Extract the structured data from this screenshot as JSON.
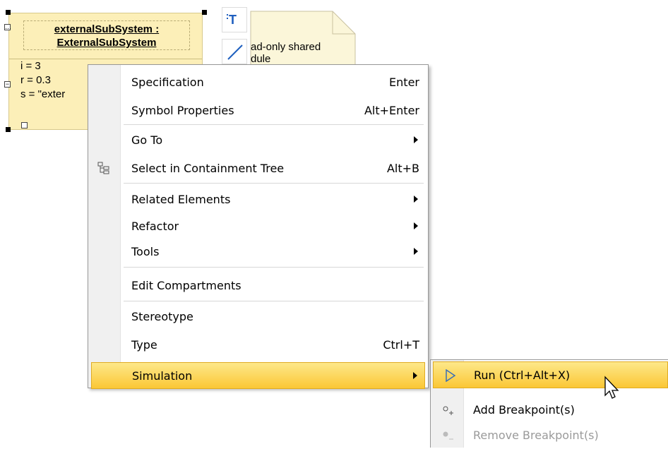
{
  "diagram": {
    "instance": {
      "name_line1": "externalSubSystem :",
      "name_line2": "ExternalSubSystem",
      "slots": [
        "i = 3",
        "r = 0.3",
        "s = \"exter"
      ]
    },
    "note_text": [
      "ad-only shared",
      "dule"
    ]
  },
  "context_menu": {
    "items": [
      {
        "label": "Specification",
        "shortcut": "Enter"
      },
      {
        "label": "Symbol Properties",
        "shortcut": "Alt+Enter"
      },
      {
        "label": "Go To",
        "shortcut": ""
      },
      {
        "label": "Select in Containment Tree",
        "shortcut": "Alt+B"
      },
      {
        "label": "Related Elements",
        "shortcut": ""
      },
      {
        "label": "Refactor",
        "shortcut": ""
      },
      {
        "label": "Tools",
        "shortcut": ""
      },
      {
        "label": "Edit Compartments",
        "shortcut": ""
      },
      {
        "label": "Stereotype",
        "shortcut": ""
      },
      {
        "label": "Type",
        "shortcut": "Ctrl+T"
      },
      {
        "label": "Simulation",
        "shortcut": ""
      }
    ],
    "highlight_item": "Simulation"
  },
  "submenu": {
    "items": [
      {
        "label": "Run (Ctrl+Alt+X)",
        "icon": "play-icon"
      },
      {
        "label": "Add Breakpoint(s)",
        "icon": "add-breakpoint-icon"
      },
      {
        "label": "Remove Breakpoint(s)",
        "icon": "remove-breakpoint-icon",
        "disabled": true
      }
    ]
  },
  "colors": {
    "instance_fill": "#fcefb8",
    "highlight": "#fbc735",
    "menu_gutter": "#f0f0f0"
  }
}
